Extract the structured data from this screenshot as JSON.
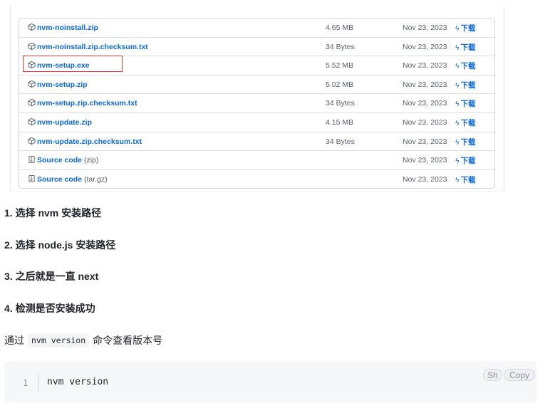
{
  "release_assets": [
    {
      "name": "nvm-noinstall.zip",
      "ext": "",
      "icon": "package-icon",
      "size": "4.65 MB",
      "date": "Nov 23, 2023"
    },
    {
      "name": "nvm-noinstall.zip.checksum.txt",
      "ext": "",
      "icon": "package-icon",
      "size": "34 Bytes",
      "date": "Nov 23, 2023"
    },
    {
      "name": "nvm-setup.exe",
      "ext": "",
      "icon": "package-icon",
      "size": "5.52 MB",
      "date": "Nov 23, 2023"
    },
    {
      "name": "nvm-setup.zip",
      "ext": "",
      "icon": "package-icon",
      "size": "5.02 MB",
      "date": "Nov 23, 2023"
    },
    {
      "name": "nvm-setup.zip.checksum.txt",
      "ext": "",
      "icon": "package-icon",
      "size": "34 Bytes",
      "date": "Nov 23, 2023"
    },
    {
      "name": "nvm-update.zip",
      "ext": "",
      "icon": "package-icon",
      "size": "4.15 MB",
      "date": "Nov 23, 2023"
    },
    {
      "name": "nvm-update.zip.checksum.txt",
      "ext": "",
      "icon": "package-icon",
      "size": "34 Bytes",
      "date": "Nov 23, 2023"
    },
    {
      "name": "Source code",
      "ext": "(zip)",
      "icon": "file-zip-icon",
      "size": "",
      "date": "Nov 23, 2023"
    },
    {
      "name": "Source code",
      "ext": "(tar.gz)",
      "icon": "file-zip-icon",
      "size": "",
      "date": "Nov 23, 2023"
    }
  ],
  "download_label": "下载",
  "highlighted_asset": "nvm-setup.exe",
  "steps": [
    "1. 选择 nvm 安装路径",
    "2. 选择 node.js 安装路径",
    "3. 之后就是一直 next",
    "4. 检测是否安装成功"
  ],
  "paragraph": {
    "before": "通过",
    "code": "nvm version",
    "after": "命令查看版本号"
  },
  "code_block": {
    "line_number": "1",
    "code": "nvm version",
    "lang_button": "Sh",
    "copy_button": "Copy"
  },
  "colors": {
    "link": "#0969da",
    "highlight_border": "#e53935",
    "muted": "#57606a"
  }
}
